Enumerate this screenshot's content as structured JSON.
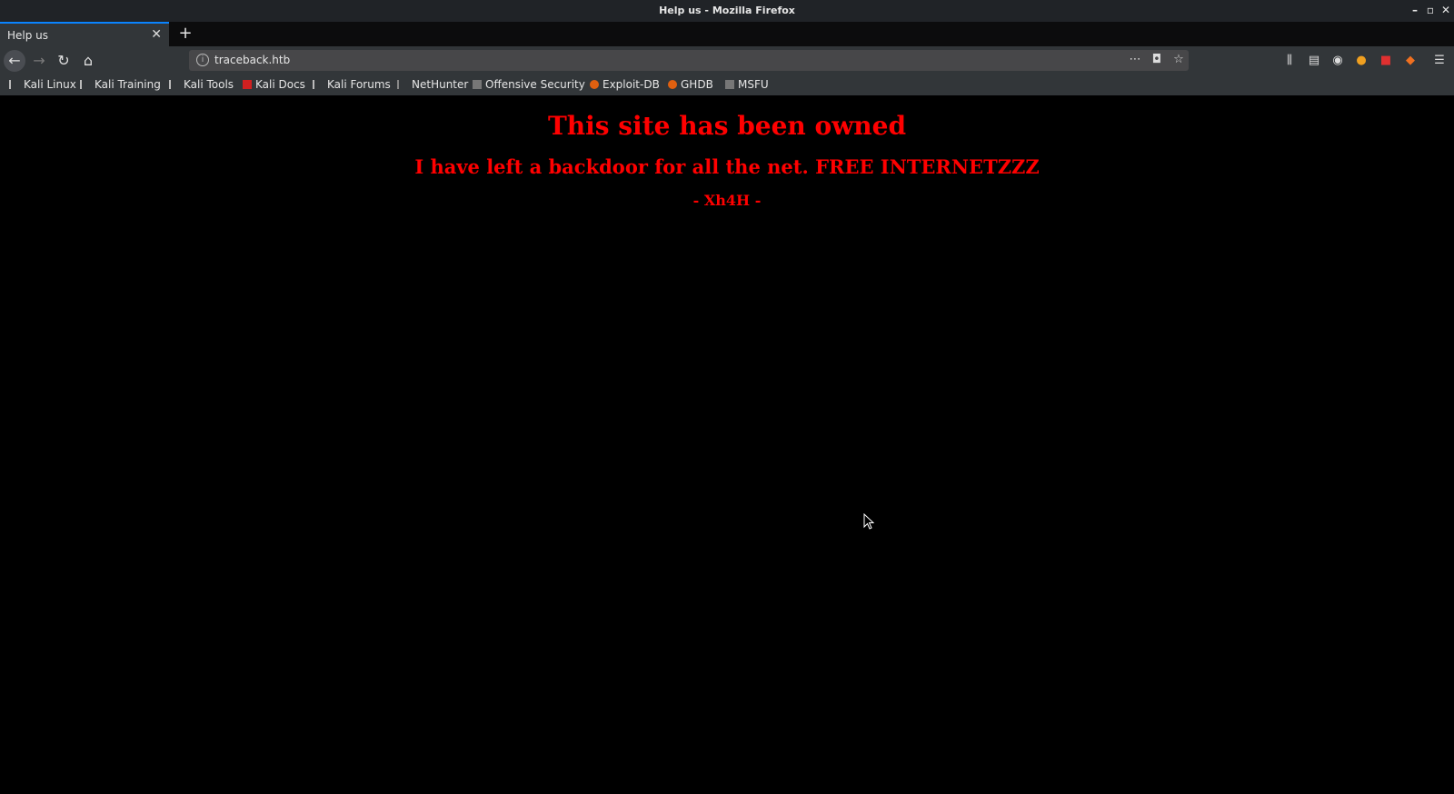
{
  "window": {
    "title": "Help us - Mozilla Firefox"
  },
  "tab": {
    "title": "Help us"
  },
  "urlbar": {
    "url": "traceback.htb"
  },
  "bookmarks": [
    {
      "label": "Kali Linux",
      "icon": "kali-dragon-icon"
    },
    {
      "label": "Kali Training",
      "icon": "kali-dragon-icon"
    },
    {
      "label": "Kali Tools",
      "icon": "kali-dragon-icon"
    },
    {
      "label": "Kali Docs",
      "icon": "kali-docs-icon"
    },
    {
      "label": "Kali Forums",
      "icon": "kali-dragon-icon"
    },
    {
      "label": "NetHunter",
      "icon": "nethunter-icon"
    },
    {
      "label": "Offensive Security",
      "icon": "offsec-icon"
    },
    {
      "label": "Exploit-DB",
      "icon": "exploitdb-icon"
    },
    {
      "label": "GHDB",
      "icon": "exploitdb-icon"
    },
    {
      "label": "MSFU",
      "icon": "offsec-icon"
    }
  ],
  "page": {
    "heading": "This site has been owned",
    "subheading": "I have left a backdoor for all the net. FREE INTERNETZZZ",
    "signature": "- Xh4H -"
  },
  "colors": {
    "page_text": "#ff0000",
    "page_bg": "#000000",
    "accent": "#0a84ff"
  }
}
